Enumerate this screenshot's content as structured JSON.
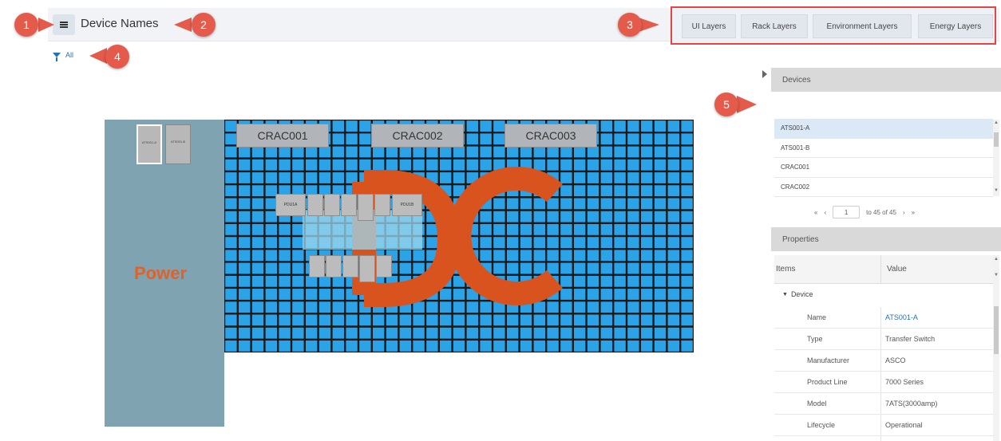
{
  "header": {
    "menu_icon": "hamburger-icon",
    "title": "Device Names"
  },
  "layers": [
    {
      "label": "UI Layers"
    },
    {
      "label": "Rack Layers"
    },
    {
      "label": "Environment Layers"
    },
    {
      "label": "Energy Layers"
    }
  ],
  "filter": {
    "icon": "filter-icon",
    "label": "All"
  },
  "callouts": [
    "1",
    "2",
    "3",
    "4",
    "5"
  ],
  "floor": {
    "power_label": "Power",
    "power_devices": [
      "ATS001-A",
      "ATS001-B"
    ],
    "cracs": [
      "CRAC001",
      "CRAC002",
      "CRAC003"
    ],
    "pdu_labels": [
      "PDU1A",
      "PDU1B"
    ],
    "logo_text": "DC",
    "colors": {
      "grid_tile": "#2aa3e8",
      "grid_line": "#1a1a1a",
      "power_zone": "#7fa3b0",
      "logo": "#d9531e"
    }
  },
  "devices_panel": {
    "title": "Devices",
    "items": [
      "ATS001-A",
      "ATS001-B",
      "CRAC001",
      "CRAC002"
    ],
    "selected_index": 0,
    "pager": {
      "current": "1",
      "summary": "to 45 of 45"
    }
  },
  "properties_panel": {
    "title": "Properties",
    "col_items": "Items",
    "col_value": "Value",
    "group": "Device",
    "rows": [
      {
        "key": "Name",
        "value": "ATS001-A"
      },
      {
        "key": "Type",
        "value": "Transfer Switch"
      },
      {
        "key": "Manufacturer",
        "value": "ASCO"
      },
      {
        "key": "Product Line",
        "value": "7000 Series"
      },
      {
        "key": "Model",
        "value": "7ATS(3000amp)"
      },
      {
        "key": "Lifecycle",
        "value": "Operational"
      }
    ]
  }
}
